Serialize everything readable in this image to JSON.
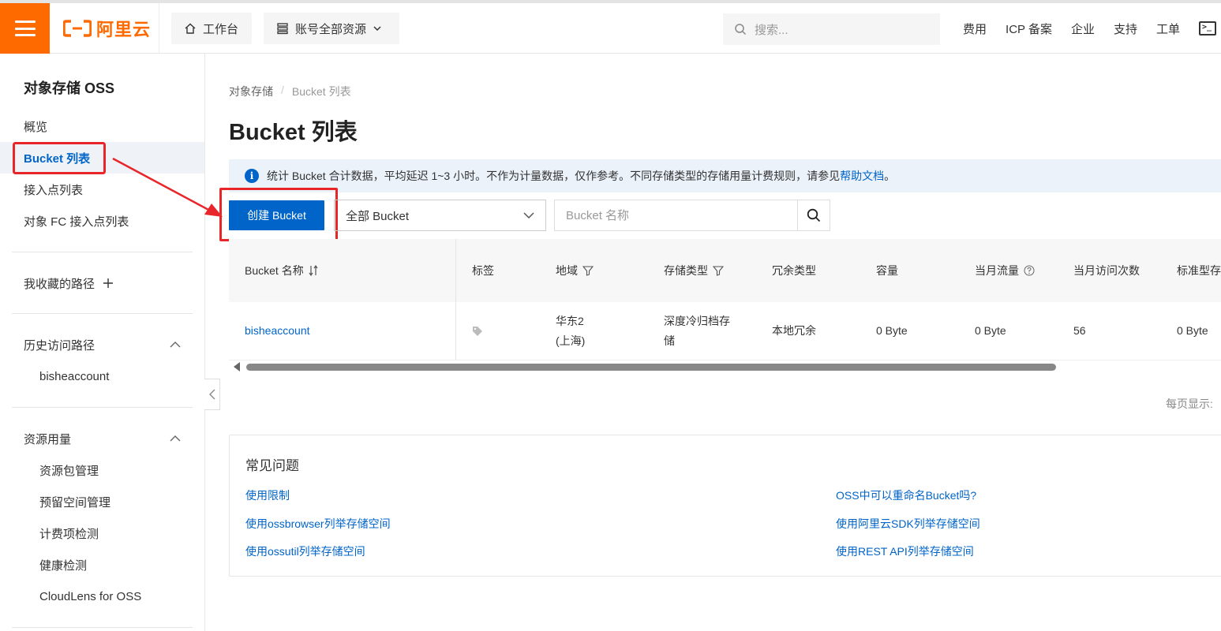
{
  "header": {
    "logo_text": "阿里云",
    "workbench": "工作台",
    "resources": "账号全部资源",
    "search_placeholder": "搜索...",
    "links": [
      "费用",
      "ICP 备案",
      "企业",
      "支持",
      "工单"
    ],
    "brand_color": "#ff6a00"
  },
  "sidebar": {
    "title": "对象存储 OSS",
    "items": [
      "概览",
      "Bucket 列表",
      "接入点列表",
      "对象 FC 接入点列表"
    ],
    "favorites": "我收藏的路径",
    "history": {
      "label": "历史访问路径",
      "items": [
        "bisheaccount"
      ]
    },
    "usage": {
      "label": "资源用量",
      "items": [
        "资源包管理",
        "预留空间管理",
        "计费项检测",
        "健康检测",
        "CloudLens for OSS"
      ]
    }
  },
  "main": {
    "breadcrumb": [
      "对象存储",
      "Bucket 列表"
    ],
    "title": "Bucket 列表",
    "notice_text": "统计 Bucket 合计数据，平均延迟 1~3 小时。不作为计量数据，仅作参考。不同存储类型的存储用量计费规则，请参见",
    "notice_link": "帮助文档",
    "notice_end": "。",
    "create_button": "创建 Bucket",
    "filter_select": "全部 Bucket",
    "name_placeholder": "Bucket 名称",
    "per_page": "每页显示:",
    "accent_color": "#0064c8"
  },
  "table": {
    "headers": [
      "Bucket 名称",
      "标签",
      "地域",
      "存储类型",
      "冗余类型",
      "容量",
      "当月流量",
      "当月访问次数",
      "标准型存"
    ],
    "rows": [
      {
        "name": "bisheaccount",
        "region_line1": "华东2",
        "region_line2": "(上海)",
        "storage_line1": "深度冷归档存",
        "storage_line2": "储",
        "redundancy": "本地冗余",
        "capacity": "0 Byte",
        "traffic": "0 Byte",
        "visits": "56",
        "standard": "0 Byte"
      }
    ]
  },
  "faq": {
    "title": "常见问题",
    "links": [
      "使用限制",
      "使用ossbrowser列举存储空间",
      "使用ossutil列举存储空间",
      "OSS中可以重命名Bucket吗?",
      "使用阿里云SDK列举存储空间",
      "使用REST API列举存储空间"
    ]
  }
}
